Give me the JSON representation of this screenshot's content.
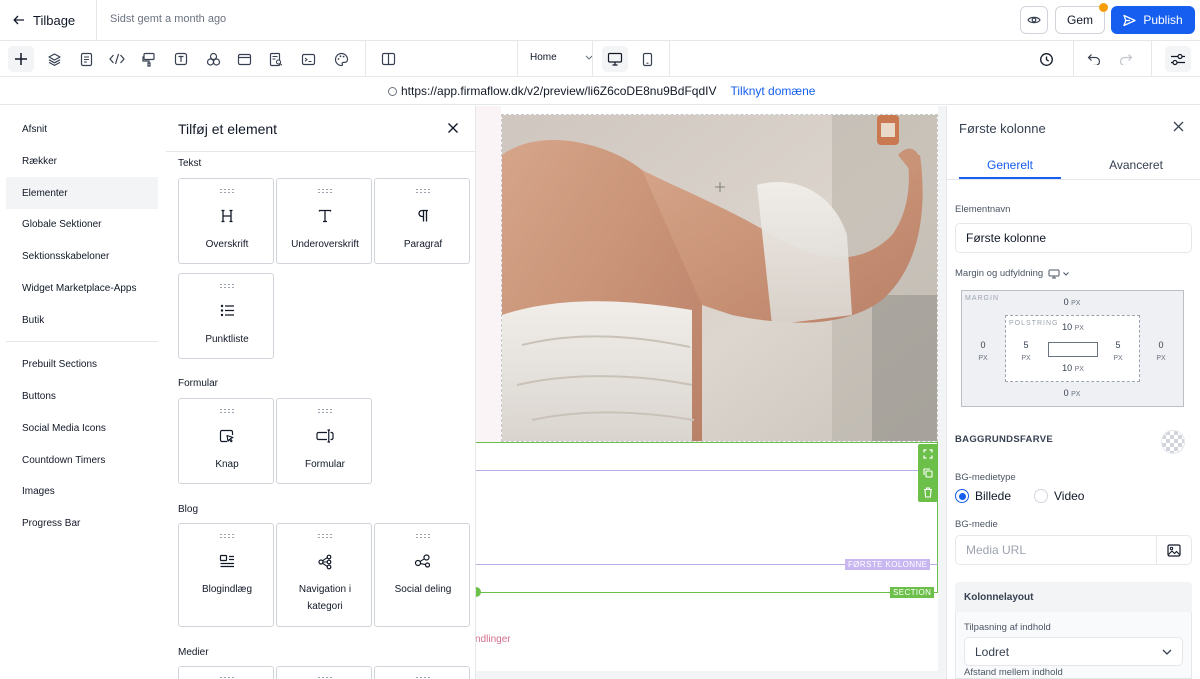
{
  "topbar": {
    "back_label": "Tilbage",
    "saved_status": "Sidst gemt a month ago",
    "save_label": "Gem",
    "publish_label": "Publish"
  },
  "toolbar": {
    "page_select": "Home"
  },
  "urlbar": {
    "url": "https://app.firmaflow.dk/v2/preview/li6Z6coDE8nu9BdFqdIV",
    "domain_link": "Tilknyt domæne"
  },
  "leftnav": {
    "items": [
      "Afsnit",
      "Rækker",
      "Elementer",
      "Globale Sektioner",
      "Sektionsskabeloner",
      "Widget Marketplace-Apps",
      "Butik"
    ],
    "items2": [
      "Prebuilt Sections",
      "Buttons",
      "Social Media Icons",
      "Countdown Timers",
      "Images",
      "Progress Bar"
    ]
  },
  "element_panel": {
    "title": "Tilføj et element",
    "sections": {
      "tekst": "Tekst",
      "formular": "Formular",
      "blog": "Blog",
      "medier": "Medier"
    },
    "cards": {
      "overskrift": "Overskrift",
      "underoverskrift": "Underoverskrift",
      "paragraf": "Paragraf",
      "punktliste": "Punktliste",
      "knap": "Knap",
      "formular": "Formular",
      "blogindlaeg": "Blogindlæg",
      "navigation": "Navigation i kategori",
      "social": "Social deling"
    }
  },
  "canvas": {
    "column_tag": "FØRSTE KOLONNE",
    "section_tag": "SECTION",
    "partial_text": "ndlinger"
  },
  "right_panel": {
    "title": "Første kolonne",
    "tab_general": "Generelt",
    "tab_advanced": "Avanceret",
    "element_name_label": "Elementnavn",
    "element_name_value": "Første kolonne",
    "spacing_label": "Margin og udfyldning",
    "margin_label": "MARGIN",
    "padding_label": "POLSTRING",
    "unit": "PX",
    "margin": {
      "top": "0",
      "right": "0",
      "bottom": "0",
      "left": "0"
    },
    "padding": {
      "top": "10",
      "right": "5",
      "bottom": "10",
      "left": "5"
    },
    "bg_color_title": "BAGGRUNDSFARVE",
    "bg_media_type_label": "BG-medietype",
    "radio_image": "Billede",
    "radio_video": "Video",
    "bg_media_label": "BG-medie",
    "media_placeholder": "Media URL",
    "layout_title": "Kolonnelayout",
    "fit_label": "Tilpasning af indhold",
    "fit_value": "Lodret",
    "gap_label": "Afstand mellem indhold"
  },
  "colors": {
    "accent": "#155eef",
    "section_outline": "#6cc04a",
    "column_tag": "#c9b7f2"
  }
}
